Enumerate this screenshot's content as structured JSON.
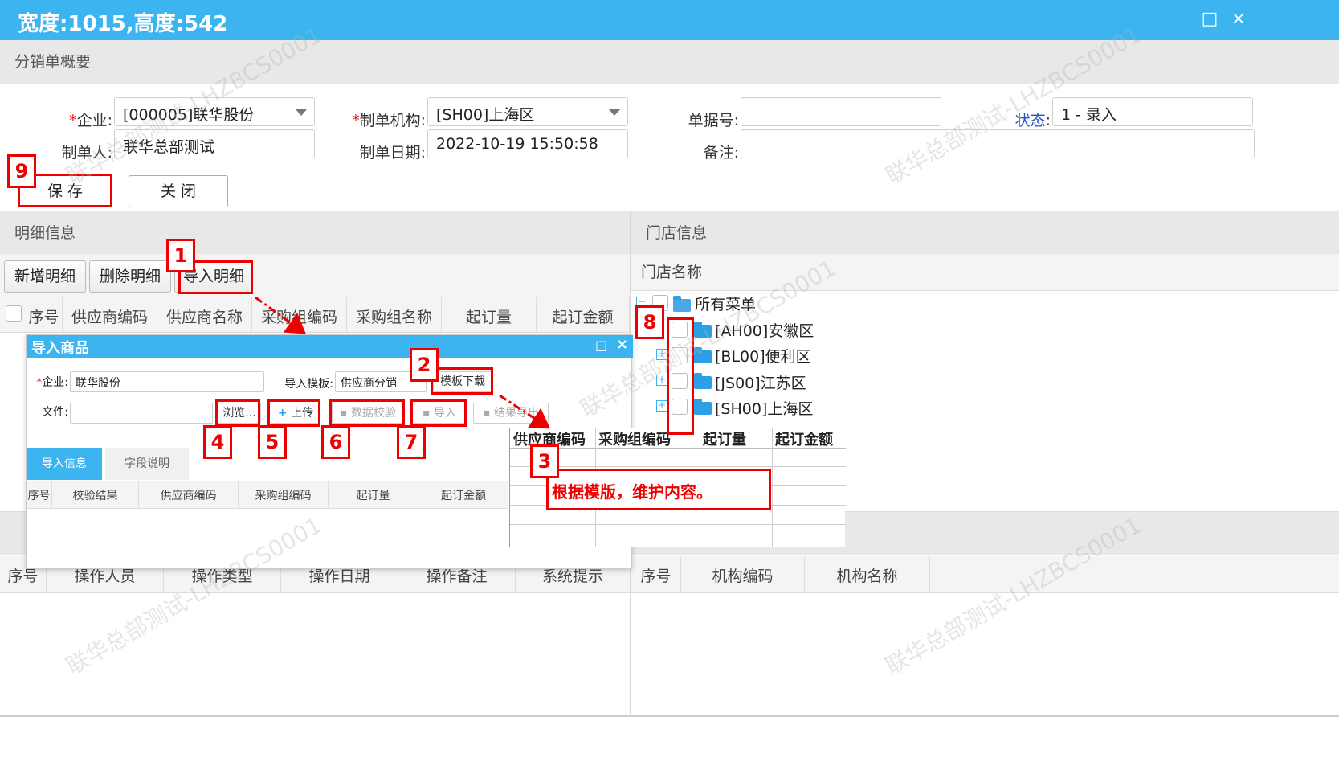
{
  "window": {
    "title": "宽度:1015,高度:542",
    "maximize_icon": "□",
    "close_icon": "×"
  },
  "summary": {
    "section_title": "分销单概要",
    "company_label": "企业:",
    "company_value": "[000005]联华股份",
    "org_label": "制单机构:",
    "org_value": "[SH00]上海区",
    "doc_no_label": "单据号:",
    "doc_no_value": "",
    "status_label": "状态",
    "status_colon": ":",
    "status_value": "1 - 录入",
    "maker_label": "制单人:",
    "maker_value": "联华总部测试",
    "date_label": "制单日期:",
    "date_value": "2022-10-19 15:50:58",
    "remark_label": "备注:",
    "remark_value": "",
    "required_mark": "*",
    "save_label": "保 存",
    "close_label": "关 闭"
  },
  "detail": {
    "section_title": "明细信息",
    "add_label": "新增明细",
    "delete_label": "删除明细",
    "import_label": "导入明细",
    "columns": [
      "序号",
      "供应商编码",
      "供应商名称",
      "采购组编码",
      "采购组名称",
      "起订量",
      "起订金额"
    ]
  },
  "store": {
    "section_title": "门店信息",
    "column_label": "门店名称",
    "tree": {
      "root": "所有菜单",
      "children": [
        "[AH00]安徽区",
        "[BL00]便利区",
        "[JS00]江苏区",
        "[SH00]上海区"
      ]
    },
    "bottom_columns": [
      "序号",
      "机构编码",
      "机构名称"
    ]
  },
  "oplog": {
    "columns": [
      "序号",
      "操作人员",
      "操作类型",
      "操作日期",
      "操作备注",
      "系统提示"
    ]
  },
  "dialog": {
    "title": "导入商品",
    "company_label": "企业:",
    "company_value": "联华股份",
    "template_label": "导入模板:",
    "template_value": "供应商分销",
    "template_download": "模板下载",
    "file_label": "文件:",
    "browse": "浏览...",
    "upload": "上传",
    "validate": "数据校验",
    "import": "导入",
    "export": "结果导出",
    "tabs": [
      "导入信息",
      "字段说明"
    ],
    "columns": [
      "序号",
      "校验结果",
      "供应商编码",
      "采购组编码",
      "起订量",
      "起订金额"
    ]
  },
  "template_sheet": {
    "columns": [
      "供应商编码",
      "采购组编码",
      "起订量",
      "起订金额"
    ]
  },
  "annotations": {
    "numbers": [
      "1",
      "2",
      "3",
      "4",
      "5",
      "6",
      "7",
      "8",
      "9"
    ],
    "note": "根据模版，维护内容。"
  },
  "watermark": "联华总部测试-LHZBCS0001",
  "colors": {
    "title_bar": "#3bb4ef",
    "annotation_red": "#e00000",
    "status_link": "#2255cc"
  }
}
